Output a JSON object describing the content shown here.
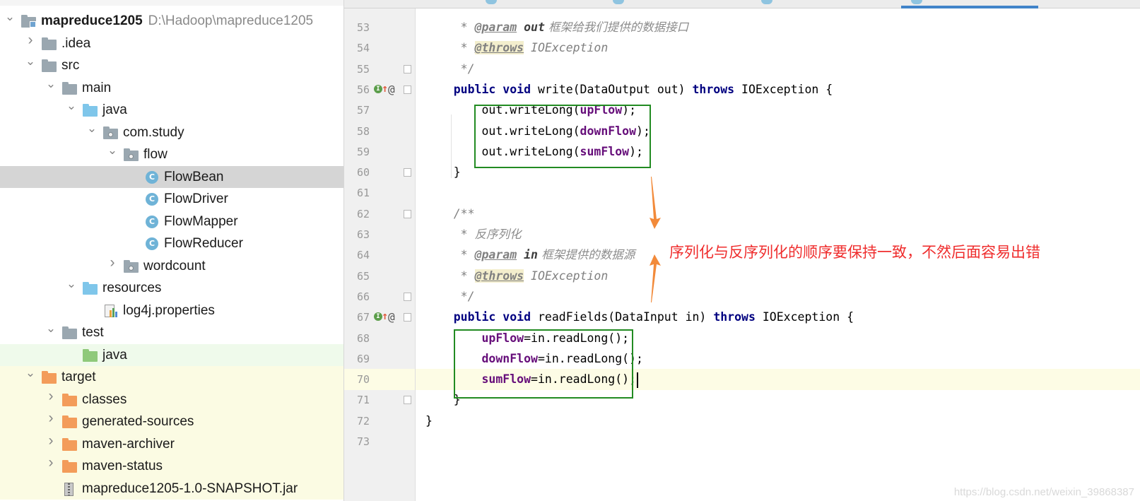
{
  "project": {
    "root_name": "mapreduce1205",
    "root_path": "D:\\Hadoop\\mapreduce1205",
    "tree": [
      {
        "label": "mapreduce1205",
        "depth": 0,
        "arrow": "down",
        "icon": "module-folder-icon"
      },
      {
        "label": ".idea",
        "depth": 1,
        "arrow": "right",
        "icon": "grey-folder-icon"
      },
      {
        "label": "src",
        "depth": 1,
        "arrow": "down",
        "icon": "grey-folder-icon"
      },
      {
        "label": "main",
        "depth": 2,
        "arrow": "down",
        "icon": "grey-folder-icon"
      },
      {
        "label": "java",
        "depth": 3,
        "arrow": "down",
        "icon": "source-folder-icon"
      },
      {
        "label": "com.study",
        "depth": 4,
        "arrow": "down",
        "icon": "package-icon"
      },
      {
        "label": "flow",
        "depth": 5,
        "arrow": "down",
        "icon": "package-icon"
      },
      {
        "label": "FlowBean",
        "depth": 6,
        "arrow": "none",
        "icon": "java-class-icon",
        "selected": true
      },
      {
        "label": "FlowDriver",
        "depth": 6,
        "arrow": "none",
        "icon": "java-class-icon"
      },
      {
        "label": "FlowMapper",
        "depth": 6,
        "arrow": "none",
        "icon": "java-class-icon"
      },
      {
        "label": "FlowReducer",
        "depth": 6,
        "arrow": "none",
        "icon": "java-class-icon"
      },
      {
        "label": "wordcount",
        "depth": 5,
        "arrow": "right",
        "icon": "package-icon"
      },
      {
        "label": "resources",
        "depth": 3,
        "arrow": "down",
        "icon": "resources-folder-icon"
      },
      {
        "label": "log4j.properties",
        "depth": 4,
        "arrow": "none",
        "icon": "properties-file-icon"
      },
      {
        "label": "test",
        "depth": 2,
        "arrow": "down",
        "icon": "grey-folder-icon"
      },
      {
        "label": "java",
        "depth": 3,
        "arrow": "none",
        "icon": "test-source-folder-icon",
        "test": true
      },
      {
        "label": "target",
        "depth": 1,
        "arrow": "down",
        "icon": "excluded-folder-icon",
        "excluded": true
      },
      {
        "label": "classes",
        "depth": 2,
        "arrow": "right",
        "icon": "excluded-folder-icon",
        "excluded": true
      },
      {
        "label": "generated-sources",
        "depth": 2,
        "arrow": "right",
        "icon": "excluded-folder-icon",
        "excluded": true
      },
      {
        "label": "maven-archiver",
        "depth": 2,
        "arrow": "right",
        "icon": "excluded-folder-icon",
        "excluded": true
      },
      {
        "label": "maven-status",
        "depth": 2,
        "arrow": "right",
        "icon": "excluded-folder-icon",
        "excluded": true
      },
      {
        "label": "mapreduce1205-1.0-SNAPSHOT.jar",
        "depth": 2,
        "arrow": "none",
        "icon": "jar-file-icon",
        "excluded": true
      }
    ]
  },
  "editor": {
    "current_line": "70",
    "lines": [
      {
        "n": "53",
        "parts": [
          [
            "cmt",
            "     * "
          ],
          [
            "tagparam",
            "@param"
          ],
          [
            "cmt",
            " "
          ],
          [
            "pname",
            "out"
          ],
          [
            "cmtcn",
            " 框架给我们提供的数据接口"
          ]
        ]
      },
      {
        "n": "54",
        "parts": [
          [
            "cmt",
            "     * "
          ],
          [
            "tagc",
            "@throws"
          ],
          [
            "cmt",
            " IOException"
          ]
        ]
      },
      {
        "n": "55",
        "parts": [
          [
            "cmt",
            "     */"
          ]
        ],
        "fold": true
      },
      {
        "n": "56",
        "parts": [
          [
            "kw",
            "    public void "
          ],
          [
            "plain",
            "write(DataOutput out) "
          ],
          [
            "kw",
            "throws "
          ],
          [
            "plain",
            "IOException {"
          ]
        ],
        "fold": true,
        "markers": true
      },
      {
        "n": "57",
        "parts": [
          [
            "plain",
            "        out.writeLong("
          ],
          [
            "fld",
            "upFlow"
          ],
          [
            "plain",
            ");"
          ]
        ]
      },
      {
        "n": "58",
        "parts": [
          [
            "plain",
            "        out.writeLong("
          ],
          [
            "fld",
            "downFlow"
          ],
          [
            "plain",
            ");"
          ]
        ]
      },
      {
        "n": "59",
        "parts": [
          [
            "plain",
            "        out.writeLong("
          ],
          [
            "fld",
            "sumFlow"
          ],
          [
            "plain",
            ");"
          ]
        ]
      },
      {
        "n": "60",
        "parts": [
          [
            "plain",
            "    }"
          ]
        ],
        "fold": true
      },
      {
        "n": "61",
        "parts": []
      },
      {
        "n": "62",
        "parts": [
          [
            "cmt",
            "    /**"
          ]
        ],
        "fold": true
      },
      {
        "n": "63",
        "parts": [
          [
            "cmt",
            "     * "
          ],
          [
            "cmtcn",
            "反序列化"
          ]
        ]
      },
      {
        "n": "64",
        "parts": [
          [
            "cmt",
            "     * "
          ],
          [
            "tagparam",
            "@param"
          ],
          [
            "cmt",
            " "
          ],
          [
            "pname",
            "in"
          ],
          [
            "cmtcn",
            " 框架提供的数据源"
          ]
        ]
      },
      {
        "n": "65",
        "parts": [
          [
            "cmt",
            "     * "
          ],
          [
            "tagc",
            "@throws"
          ],
          [
            "cmt",
            " IOException"
          ]
        ]
      },
      {
        "n": "66",
        "parts": [
          [
            "cmt",
            "     */"
          ]
        ],
        "fold": true
      },
      {
        "n": "67",
        "parts": [
          [
            "kw",
            "    public void "
          ],
          [
            "plain",
            "readFields(DataInput in) "
          ],
          [
            "kw",
            "throws "
          ],
          [
            "plain",
            "IOException {"
          ]
        ],
        "fold": true,
        "markers": true
      },
      {
        "n": "68",
        "parts": [
          [
            "plain",
            "        "
          ],
          [
            "fld",
            "upFlow"
          ],
          [
            "plain",
            "=in.readLong();"
          ]
        ]
      },
      {
        "n": "69",
        "parts": [
          [
            "plain",
            "        "
          ],
          [
            "fld",
            "downFlow"
          ],
          [
            "plain",
            "=in.readLong();"
          ]
        ]
      },
      {
        "n": "70",
        "parts": [
          [
            "plain",
            "        "
          ],
          [
            "fld",
            "sumFlow"
          ],
          [
            "plain",
            "=in.readLong();"
          ]
        ],
        "caret": true
      },
      {
        "n": "71",
        "parts": [
          [
            "plain",
            "    }"
          ]
        ],
        "fold": true
      },
      {
        "n": "72",
        "parts": [
          [
            "plain",
            "}"
          ]
        ]
      },
      {
        "n": "73",
        "parts": []
      }
    ]
  },
  "annotation": {
    "text": "序列化与反序列化的顺序要保持一致，不然后面容易出错",
    "color": "#ef2d2d",
    "arrow_color": "#f28a3a",
    "box_color": "#228b22"
  },
  "watermark": "https://blog.csdn.net/weixin_39868387"
}
